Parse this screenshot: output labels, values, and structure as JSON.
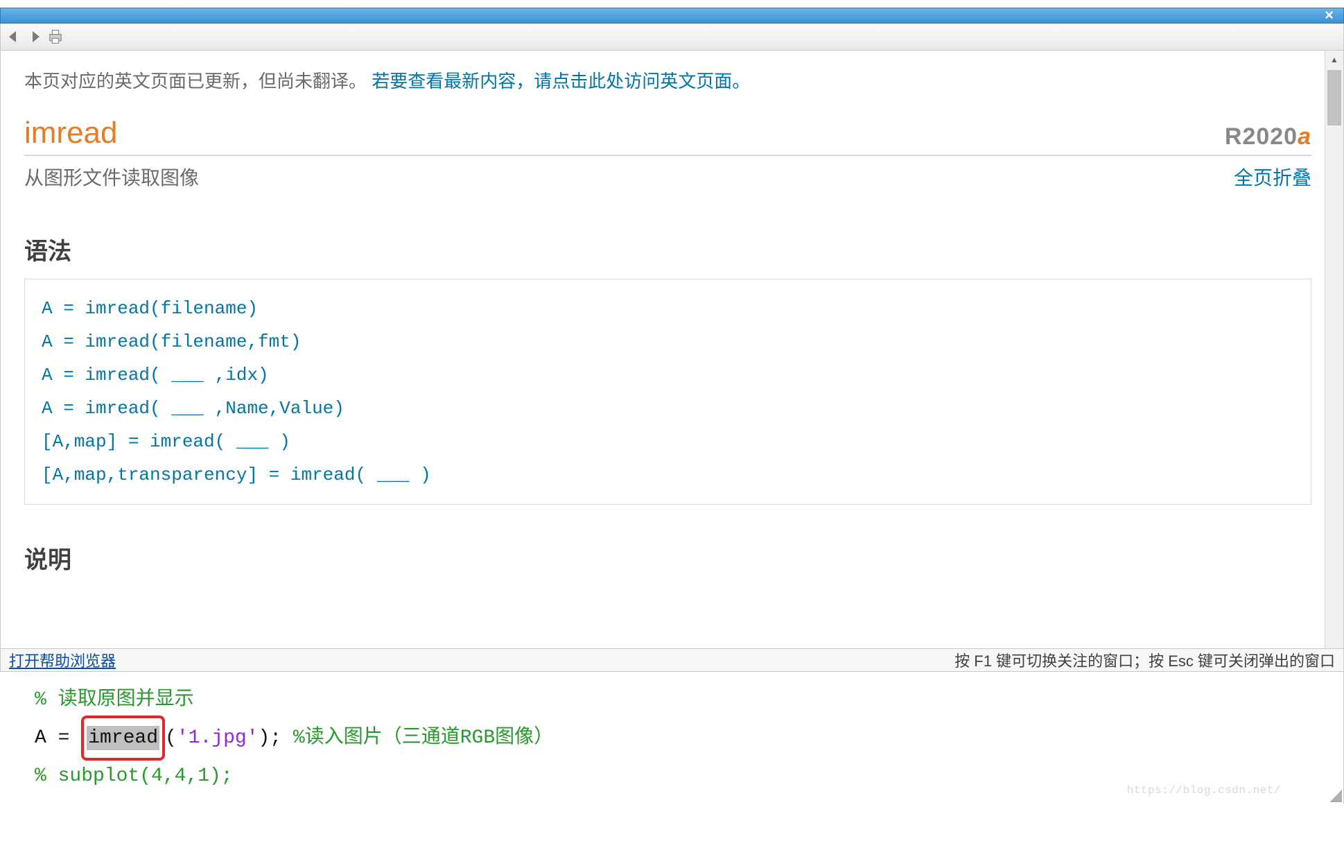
{
  "notice": {
    "text_before": "本页对应的英文页面已更新，但尚未翻译。 ",
    "link_text": "若要查看最新内容，请点击此处访问英文页面。"
  },
  "header": {
    "function_name": "imread",
    "version_R": "R",
    "version_year": "2020",
    "version_suffix": "a",
    "short_desc": "从图形文件读取图像",
    "collapse_label": "全页折叠"
  },
  "sections": {
    "syntax_title": "语法",
    "description_title": "说明"
  },
  "syntax_lines": [
    "A = imread(filename)",
    "A = imread(filename,fmt)",
    "A = imread( ___ ,idx)",
    "A = imread( ___ ,Name,Value)",
    "[A,map] = imread( ___ )",
    "[A,map,transparency] = imread( ___ )"
  ],
  "footer": {
    "help_link": "打开帮助浏览器",
    "hint": "按 F1 键可切换关注的窗口；按 Esc 键可关闭弹出的窗口"
  },
  "code": {
    "line1_comment": "% 读取原图并显示",
    "line2_A": "A = ",
    "line2_imread": "imread",
    "line2_open": "(",
    "line2_quote1": "'",
    "line2_file": "1.jpg",
    "line2_quote2": "'",
    "line2_close": "); ",
    "line2_comment": "%读入图片（三通道RGB图像）",
    "line3_pct": "% ",
    "line3_fn": "subplot",
    "line3_args": "(4,4,1);"
  },
  "watermark": "https://blog.csdn.net/"
}
